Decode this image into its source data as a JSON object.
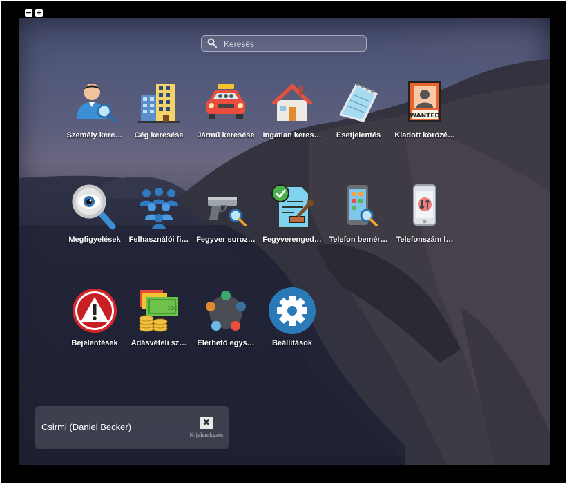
{
  "window": {
    "minimize_label": "−",
    "maximize_label": "+"
  },
  "search": {
    "placeholder": "Keresés",
    "value": ""
  },
  "apps": [
    {
      "label": "Személy kere…",
      "icon": "person-search-icon"
    },
    {
      "label": "Cég keresése",
      "icon": "building-icon"
    },
    {
      "label": "Jármű keresése",
      "icon": "taxi-car-icon"
    },
    {
      "label": "Ingatlan keres…",
      "icon": "house-icon"
    },
    {
      "label": "Esetjelentés",
      "icon": "notepad-icon"
    },
    {
      "label": "Kiadott körözé…",
      "icon": "wanted-poster-icon"
    },
    {
      "label": "Megfigyelések",
      "icon": "eye-magnifier-icon"
    },
    {
      "label": "Felhasználói fi…",
      "icon": "users-group-icon"
    },
    {
      "label": "Fegyver soroz…",
      "icon": "gun-search-icon"
    },
    {
      "label": "Fegyverenged…",
      "icon": "license-stamp-icon"
    },
    {
      "label": "Telefon bemér…",
      "icon": "phone-search-icon"
    },
    {
      "label": "Telefonszám l…",
      "icon": "phone-transfer-icon"
    },
    {
      "label": "Bejelentések",
      "icon": "warning-icon"
    },
    {
      "label": "Adásvételi sz…",
      "icon": "money-coins-icon"
    },
    {
      "label": "Elérhető egys…",
      "icon": "network-nodes-icon"
    },
    {
      "label": "Beállítások",
      "icon": "gear-icon"
    }
  ],
  "user": {
    "name": "Csirmi (Daniel Becker)",
    "logout_label": "Kijelentkezés",
    "logout_icon": "close-icon"
  },
  "colors": {
    "gear_bg": "#2a7ab8",
    "warning_red": "#d7262b",
    "taxi_red": "#e84d3d"
  }
}
